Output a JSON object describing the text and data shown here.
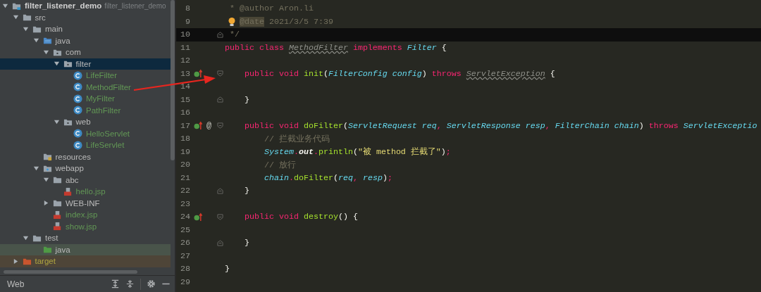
{
  "tree": [
    {
      "label": "filter_listener_demo",
      "note": "filter_listener_demo",
      "kind": "module",
      "expanded": true,
      "selected": false,
      "color": "#d0d0d0",
      "children": [
        {
          "label": "src",
          "kind": "folder",
          "expanded": true,
          "selected": false,
          "color": "#bbbbbb",
          "children": [
            {
              "label": "main",
              "kind": "folder",
              "expanded": true,
              "selected": false,
              "color": "#bbbbbb",
              "children": [
                {
                  "label": "java",
                  "kind": "source",
                  "expanded": true,
                  "selected": false,
                  "color": "#bbbbbb",
                  "children": [
                    {
                      "label": "com",
                      "kind": "package",
                      "expanded": true,
                      "selected": false,
                      "color": "#bbbbbb",
                      "children": [
                        {
                          "label": "filter",
                          "kind": "package",
                          "expanded": true,
                          "selected": true,
                          "color": "#bbbbbb",
                          "children": [
                            {
                              "label": "LifeFilter",
                              "kind": "class",
                              "selected": false,
                              "color": "#629755"
                            },
                            {
                              "label": "MethodFilter",
                              "kind": "class",
                              "selected": false,
                              "color": "#629755"
                            },
                            {
                              "label": "MyFilter",
                              "kind": "class",
                              "selected": false,
                              "color": "#629755"
                            },
                            {
                              "label": "PathFilter",
                              "kind": "class",
                              "selected": false,
                              "color": "#629755"
                            }
                          ]
                        },
                        {
                          "label": "web",
                          "kind": "package",
                          "expanded": true,
                          "selected": false,
                          "color": "#bbbbbb",
                          "children": [
                            {
                              "label": "HelloServlet",
                              "kind": "class",
                              "selected": false,
                              "color": "#629755"
                            },
                            {
                              "label": "LifeServlet",
                              "kind": "class",
                              "selected": false,
                              "color": "#629755"
                            }
                          ]
                        }
                      ]
                    }
                  ]
                },
                {
                  "label": "resources",
                  "kind": "resources",
                  "selected": false,
                  "color": "#bbbbbb"
                },
                {
                  "label": "webapp",
                  "kind": "web",
                  "expanded": true,
                  "selected": false,
                  "color": "#bbbbbb",
                  "children": [
                    {
                      "label": "abc",
                      "kind": "folder",
                      "expanded": true,
                      "selected": false,
                      "color": "#bbbbbb",
                      "children": [
                        {
                          "label": "hello.jsp",
                          "kind": "jsp",
                          "selected": false,
                          "color": "#629755"
                        }
                      ]
                    },
                    {
                      "label": "WEB-INF",
                      "kind": "folder",
                      "expanded": false,
                      "selected": false,
                      "color": "#bbbbbb"
                    },
                    {
                      "label": "index.jsp",
                      "kind": "jsp",
                      "selected": false,
                      "color": "#629755"
                    },
                    {
                      "label": "show.jsp",
                      "kind": "jsp",
                      "selected": false,
                      "color": "#629755"
                    }
                  ]
                }
              ]
            },
            {
              "label": "test",
              "kind": "folder",
              "expanded": true,
              "selected": false,
              "color": "#bbbbbb",
              "children": [
                {
                  "label": "java",
                  "kind": "test-root",
                  "selected": false,
                  "color": "#bbbbbb"
                }
              ]
            }
          ]
        },
        {
          "label": "target",
          "kind": "excluded",
          "expanded": false,
          "selected": false,
          "color": "#b0a640"
        }
      ]
    }
  ],
  "bottom_bar": {
    "title": "Web"
  },
  "editor": {
    "lines": [
      {
        "number": "8",
        "tokens": [
          {
            "text": " * @author Aron.li",
            "kind": "comment"
          }
        ]
      },
      {
        "number": "9",
        "bulb": true,
        "tokens": [
          {
            "text": "@date",
            "kind": "doctag-hl"
          },
          {
            "text": " 2021/3/5 7:39",
            "kind": "comment"
          }
        ]
      },
      {
        "number": "10",
        "current": true,
        "fold_close": true,
        "tokens": [
          {
            "text": " */",
            "kind": "comment"
          }
        ]
      },
      {
        "number": "11",
        "tokens": [
          {
            "text": "public class ",
            "kind": "kw"
          },
          {
            "text": "MethodFilter",
            "kind": "cls-warn"
          },
          {
            "text": " implements",
            "kind": "kw"
          },
          {
            "text": " Filter",
            "kind": "cls"
          },
          {
            "text": " {",
            "kind": "plain"
          }
        ]
      },
      {
        "number": "12"
      },
      {
        "number": "13",
        "overridden": true,
        "fold_open": true,
        "tokens": [
          {
            "text": "    public void ",
            "kind": "kw"
          },
          {
            "text": "init",
            "kind": "fn"
          },
          {
            "text": "(",
            "kind": "plain"
          },
          {
            "text": "FilterConfig",
            "kind": "cls"
          },
          {
            "text": " config",
            "kind": "param"
          },
          {
            "text": ") ",
            "kind": "plain"
          },
          {
            "text": "throws ",
            "kind": "kw"
          },
          {
            "text": "ServletException",
            "kind": "cls-warn"
          },
          {
            "text": " {",
            "kind": "plain"
          }
        ]
      },
      {
        "number": "14"
      },
      {
        "number": "15",
        "fold_close": true,
        "tokens": [
          {
            "text": "    }",
            "kind": "plain"
          }
        ]
      },
      {
        "number": "16"
      },
      {
        "number": "17",
        "overridden": true,
        "mark_text": "@",
        "fold_open": true,
        "tokens": [
          {
            "text": "    public void ",
            "kind": "kw"
          },
          {
            "text": "doFilter",
            "kind": "fn"
          },
          {
            "text": "(",
            "kind": "plain"
          },
          {
            "text": "ServletRequest",
            "kind": "cls"
          },
          {
            "text": " req",
            "kind": "param"
          },
          {
            "text": ", ",
            "kind": "op"
          },
          {
            "text": "ServletResponse",
            "kind": "cls"
          },
          {
            "text": " resp",
            "kind": "param"
          },
          {
            "text": ", ",
            "kind": "op"
          },
          {
            "text": "FilterChain",
            "kind": "cls"
          },
          {
            "text": " chain",
            "kind": "param"
          },
          {
            "text": ") ",
            "kind": "plain"
          },
          {
            "text": "throws ",
            "kind": "kw"
          },
          {
            "text": "ServletExceptio",
            "kind": "cls"
          }
        ]
      },
      {
        "number": "18",
        "tokens": [
          {
            "text": "        // 拦截业务代码",
            "kind": "comment"
          }
        ]
      },
      {
        "number": "19",
        "tokens": [
          {
            "text": "        System",
            "kind": "cls"
          },
          {
            "text": ".",
            "kind": "op"
          },
          {
            "text": "out",
            "kind": "field"
          },
          {
            "text": ".",
            "kind": "op"
          },
          {
            "text": "println",
            "kind": "fn"
          },
          {
            "text": "(",
            "kind": "plain"
          },
          {
            "text": "\"被 method 拦截了\"",
            "kind": "str"
          },
          {
            "text": ")",
            "kind": "plain"
          },
          {
            "text": ";",
            "kind": "op"
          }
        ]
      },
      {
        "number": "20",
        "tokens": [
          {
            "text": "        // 放行",
            "kind": "comment"
          }
        ]
      },
      {
        "number": "21",
        "tokens": [
          {
            "text": "        chain",
            "kind": "param"
          },
          {
            "text": ".",
            "kind": "op"
          },
          {
            "text": "doFilter",
            "kind": "fn"
          },
          {
            "text": "(",
            "kind": "plain"
          },
          {
            "text": "req",
            "kind": "param"
          },
          {
            "text": ", ",
            "kind": "op"
          },
          {
            "text": "resp",
            "kind": "param"
          },
          {
            "text": ")",
            "kind": "plain"
          },
          {
            "text": ";",
            "kind": "op"
          }
        ]
      },
      {
        "number": "22",
        "fold_close": true,
        "tokens": [
          {
            "text": "    }",
            "kind": "plain"
          }
        ]
      },
      {
        "number": "23"
      },
      {
        "number": "24",
        "overridden": true,
        "fold_open": true,
        "tokens": [
          {
            "text": "    public void ",
            "kind": "kw"
          },
          {
            "text": "destroy",
            "kind": "fn"
          },
          {
            "text": "() {",
            "kind": "plain"
          }
        ]
      },
      {
        "number": "25"
      },
      {
        "number": "26",
        "fold_close": true,
        "tokens": [
          {
            "text": "    }",
            "kind": "plain"
          }
        ]
      },
      {
        "number": "27"
      },
      {
        "number": "28",
        "tokens": [
          {
            "text": "}",
            "kind": "plain"
          }
        ]
      },
      {
        "number": "29"
      }
    ]
  }
}
